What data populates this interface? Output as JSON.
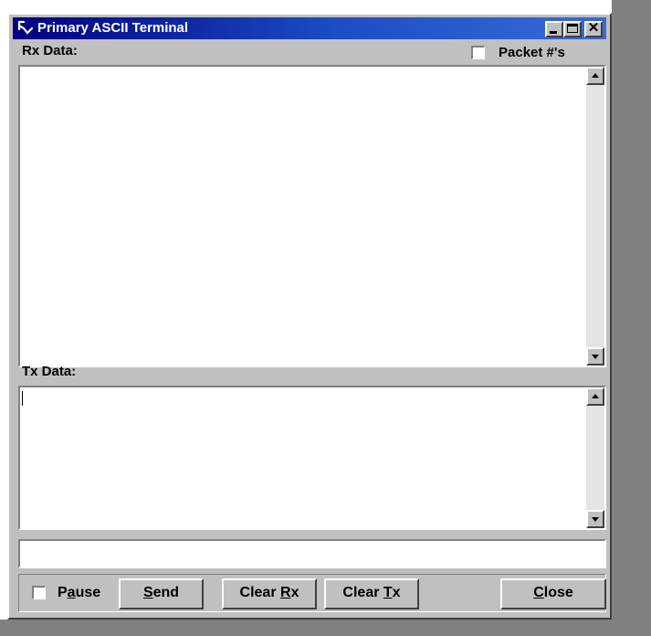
{
  "window": {
    "title": "Primary ASCII Terminal",
    "controls": {
      "minimize": "_",
      "maximize": "□",
      "close": "✕"
    },
    "title_icon": "terminal-app-icon",
    "accent_color": "#000080"
  },
  "rx": {
    "label": "Rx Data:",
    "packet_numbers_label": "Packet #'s",
    "packet_numbers_checked": false,
    "content": ""
  },
  "tx": {
    "label": "Tx Data:",
    "content": ""
  },
  "input": {
    "value": ""
  },
  "controls": {
    "pause": {
      "label_before": "P",
      "label_mnemonic": "a",
      "label_after": "use",
      "checked": false
    },
    "send": {
      "label_before": "",
      "label_mnemonic": "S",
      "label_after": "end"
    },
    "clear_rx": {
      "label_before": "Clear ",
      "label_mnemonic": "R",
      "label_after": "x"
    },
    "clear_tx": {
      "label_before": "Clear ",
      "label_mnemonic": "T",
      "label_after": "x"
    },
    "close": {
      "label_before": "",
      "label_mnemonic": "C",
      "label_after": "lose"
    }
  }
}
